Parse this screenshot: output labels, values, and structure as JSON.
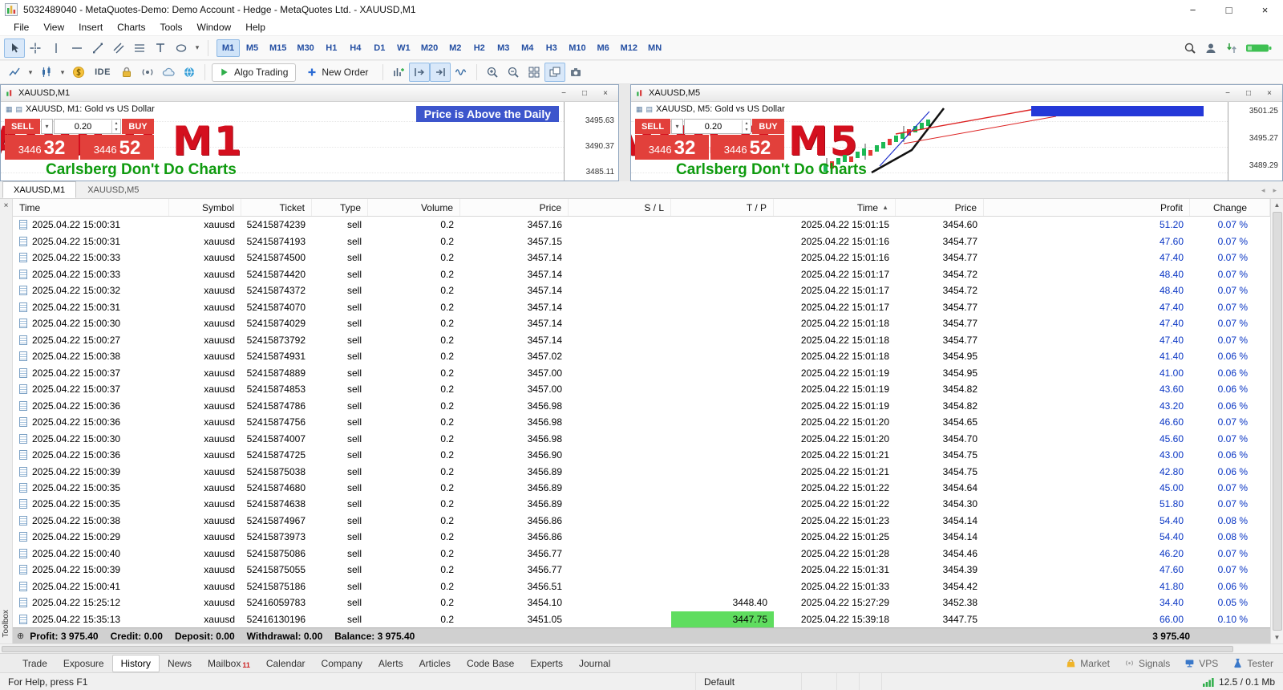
{
  "icons": {
    "minimize": "−",
    "maximize": "□",
    "close": "×",
    "dropdown": "▾",
    "spin_up": "▴",
    "spin_down": "▾",
    "sort_asc": "▲",
    "scroll_up": "▲",
    "scroll_down": "▼",
    "scroll_left": "◂",
    "scroll_right": "▸",
    "plus_circle": "⊕",
    "ohlc": "▦",
    "list": "▤"
  },
  "titlebar": {
    "title": "5032489040 - MetaQuotes-Demo: Demo Account - Hedge - MetaQuotes Ltd. - XAUUSD,M1"
  },
  "menu": {
    "items": [
      "File",
      "View",
      "Insert",
      "Charts",
      "Tools",
      "Window",
      "Help"
    ]
  },
  "toolbar1": {
    "timeframes": [
      "M1",
      "M5",
      "M15",
      "M30",
      "H1",
      "H4",
      "D1",
      "W1",
      "M20",
      "M2",
      "H2",
      "M3",
      "M4",
      "H3",
      "M10",
      "M6",
      "M12",
      "MN"
    ],
    "selected": "M1"
  },
  "toolbar2": {
    "ide": "IDE",
    "algo": "Algo Trading",
    "new_order": "New Order"
  },
  "charts": [
    {
      "title": "XAUUSD,M1",
      "info": "XAUUSD, M1:  Gold vs US Dollar",
      "sell": "SELL",
      "buy": "BUY",
      "volume": "0.20",
      "bid_big": "3446",
      "bid_pips": "32",
      "ask_big": "3446",
      "ask_pips": "52",
      "watermark": "XAUUSD M1",
      "slogan": "Carlsberg Don't Do Charts",
      "banner": "Price is Above the Daily",
      "scale": [
        "3495.63",
        "3490.37",
        "3485.11"
      ]
    },
    {
      "title": "XAUUSD,M5",
      "info": "XAUUSD, M5:  Gold vs US Dollar",
      "sell": "SELL",
      "buy": "BUY",
      "volume": "0.20",
      "bid_big": "3446",
      "bid_pips": "32",
      "ask_big": "3446",
      "ask_pips": "52",
      "watermark": "XAUUSD M5",
      "slogan": "Carlsberg Don't Do Charts",
      "scale": [
        "3501.25",
        "3495.27",
        "3489.29"
      ]
    }
  ],
  "chart_tabs": {
    "items": [
      "XAUUSD,M1",
      "XAUUSD,M5"
    ],
    "active": "XAUUSD,M1"
  },
  "history": {
    "columns": [
      "Time",
      "Symbol",
      "Ticket",
      "Type",
      "Volume",
      "Price",
      "S / L",
      "T / P",
      "Time",
      "Price",
      "Profit",
      "Change"
    ],
    "sort_column_index": 8,
    "tp_highlight_row": 24,
    "rows": [
      [
        "2025.04.22 15:00:31",
        "xauusd",
        "52415874239",
        "sell",
        "0.2",
        "3457.16",
        "",
        "",
        "2025.04.22 15:01:15",
        "3454.60",
        "51.20",
        "0.07 %"
      ],
      [
        "2025.04.22 15:00:31",
        "xauusd",
        "52415874193",
        "sell",
        "0.2",
        "3457.15",
        "",
        "",
        "2025.04.22 15:01:16",
        "3454.77",
        "47.60",
        "0.07 %"
      ],
      [
        "2025.04.22 15:00:33",
        "xauusd",
        "52415874500",
        "sell",
        "0.2",
        "3457.14",
        "",
        "",
        "2025.04.22 15:01:16",
        "3454.77",
        "47.40",
        "0.07 %"
      ],
      [
        "2025.04.22 15:00:33",
        "xauusd",
        "52415874420",
        "sell",
        "0.2",
        "3457.14",
        "",
        "",
        "2025.04.22 15:01:17",
        "3454.72",
        "48.40",
        "0.07 %"
      ],
      [
        "2025.04.22 15:00:32",
        "xauusd",
        "52415874372",
        "sell",
        "0.2",
        "3457.14",
        "",
        "",
        "2025.04.22 15:01:17",
        "3454.72",
        "48.40",
        "0.07 %"
      ],
      [
        "2025.04.22 15:00:31",
        "xauusd",
        "52415874070",
        "sell",
        "0.2",
        "3457.14",
        "",
        "",
        "2025.04.22 15:01:17",
        "3454.77",
        "47.40",
        "0.07 %"
      ],
      [
        "2025.04.22 15:00:30",
        "xauusd",
        "52415874029",
        "sell",
        "0.2",
        "3457.14",
        "",
        "",
        "2025.04.22 15:01:18",
        "3454.77",
        "47.40",
        "0.07 %"
      ],
      [
        "2025.04.22 15:00:27",
        "xauusd",
        "52415873792",
        "sell",
        "0.2",
        "3457.14",
        "",
        "",
        "2025.04.22 15:01:18",
        "3454.77",
        "47.40",
        "0.07 %"
      ],
      [
        "2025.04.22 15:00:38",
        "xauusd",
        "52415874931",
        "sell",
        "0.2",
        "3457.02",
        "",
        "",
        "2025.04.22 15:01:18",
        "3454.95",
        "41.40",
        "0.06 %"
      ],
      [
        "2025.04.22 15:00:37",
        "xauusd",
        "52415874889",
        "sell",
        "0.2",
        "3457.00",
        "",
        "",
        "2025.04.22 15:01:19",
        "3454.95",
        "41.00",
        "0.06 %"
      ],
      [
        "2025.04.22 15:00:37",
        "xauusd",
        "52415874853",
        "sell",
        "0.2",
        "3457.00",
        "",
        "",
        "2025.04.22 15:01:19",
        "3454.82",
        "43.60",
        "0.06 %"
      ],
      [
        "2025.04.22 15:00:36",
        "xauusd",
        "52415874786",
        "sell",
        "0.2",
        "3456.98",
        "",
        "",
        "2025.04.22 15:01:19",
        "3454.82",
        "43.20",
        "0.06 %"
      ],
      [
        "2025.04.22 15:00:36",
        "xauusd",
        "52415874756",
        "sell",
        "0.2",
        "3456.98",
        "",
        "",
        "2025.04.22 15:01:20",
        "3454.65",
        "46.60",
        "0.07 %"
      ],
      [
        "2025.04.22 15:00:30",
        "xauusd",
        "52415874007",
        "sell",
        "0.2",
        "3456.98",
        "",
        "",
        "2025.04.22 15:01:20",
        "3454.70",
        "45.60",
        "0.07 %"
      ],
      [
        "2025.04.22 15:00:36",
        "xauusd",
        "52415874725",
        "sell",
        "0.2",
        "3456.90",
        "",
        "",
        "2025.04.22 15:01:21",
        "3454.75",
        "43.00",
        "0.06 %"
      ],
      [
        "2025.04.22 15:00:39",
        "xauusd",
        "52415875038",
        "sell",
        "0.2",
        "3456.89",
        "",
        "",
        "2025.04.22 15:01:21",
        "3454.75",
        "42.80",
        "0.06 %"
      ],
      [
        "2025.04.22 15:00:35",
        "xauusd",
        "52415874680",
        "sell",
        "0.2",
        "3456.89",
        "",
        "",
        "2025.04.22 15:01:22",
        "3454.64",
        "45.00",
        "0.07 %"
      ],
      [
        "2025.04.22 15:00:35",
        "xauusd",
        "52415874638",
        "sell",
        "0.2",
        "3456.89",
        "",
        "",
        "2025.04.22 15:01:22",
        "3454.30",
        "51.80",
        "0.07 %"
      ],
      [
        "2025.04.22 15:00:38",
        "xauusd",
        "52415874967",
        "sell",
        "0.2",
        "3456.86",
        "",
        "",
        "2025.04.22 15:01:23",
        "3454.14",
        "54.40",
        "0.08 %"
      ],
      [
        "2025.04.22 15:00:29",
        "xauusd",
        "52415873973",
        "sell",
        "0.2",
        "3456.86",
        "",
        "",
        "2025.04.22 15:01:25",
        "3454.14",
        "54.40",
        "0.08 %"
      ],
      [
        "2025.04.22 15:00:40",
        "xauusd",
        "52415875086",
        "sell",
        "0.2",
        "3456.77",
        "",
        "",
        "2025.04.22 15:01:28",
        "3454.46",
        "46.20",
        "0.07 %"
      ],
      [
        "2025.04.22 15:00:39",
        "xauusd",
        "52415875055",
        "sell",
        "0.2",
        "3456.77",
        "",
        "",
        "2025.04.22 15:01:31",
        "3454.39",
        "47.60",
        "0.07 %"
      ],
      [
        "2025.04.22 15:00:41",
        "xauusd",
        "52415875186",
        "sell",
        "0.2",
        "3456.51",
        "",
        "",
        "2025.04.22 15:01:33",
        "3454.42",
        "41.80",
        "0.06 %"
      ],
      [
        "2025.04.22 15:25:12",
        "xauusd",
        "52416059783",
        "sell",
        "0.2",
        "3454.10",
        "",
        "3448.40",
        "2025.04.22 15:27:29",
        "3452.38",
        "34.40",
        "0.05 %"
      ],
      [
        "2025.04.22 15:35:13",
        "xauusd",
        "52416130196",
        "sell",
        "0.2",
        "3451.05",
        "",
        "3447.75",
        "2025.04.22 15:39:18",
        "3447.75",
        "66.00",
        "0.10 %"
      ]
    ],
    "summary": {
      "items": [
        "Profit: 3 975.40",
        "Credit: 0.00",
        "Deposit: 0.00",
        "Withdrawal: 0.00",
        "Balance: 3 975.40"
      ],
      "total": "3 975.40"
    }
  },
  "toolbox": {
    "label": "Toolbox"
  },
  "bottom": {
    "tabs": [
      "Trade",
      "Exposure",
      "History",
      "News",
      "Mailbox",
      "Calendar",
      "Company",
      "Alerts",
      "Articles",
      "Code Base",
      "Experts",
      "Journal"
    ],
    "active": "History",
    "mailbox_badge": "11",
    "market": "Market",
    "signals": "Signals",
    "vps": "VPS",
    "tester": "Tester"
  },
  "statusbar": {
    "help": "For Help, press F1",
    "profile": "Default",
    "traffic": "12.5 / 0.1 Mb"
  }
}
